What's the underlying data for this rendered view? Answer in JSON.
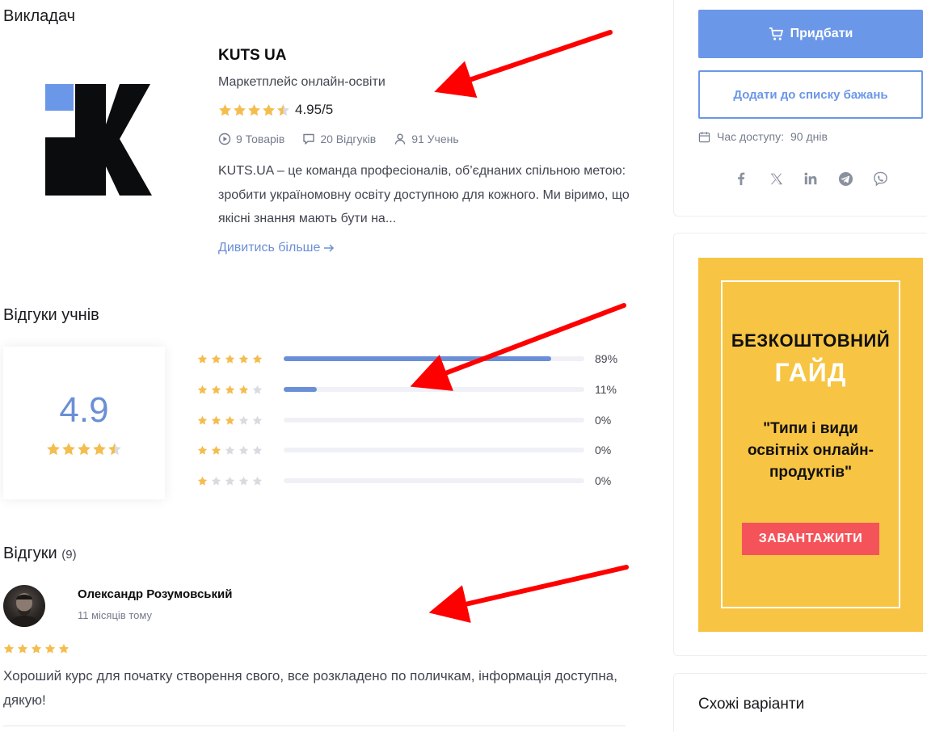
{
  "instructor": {
    "section_title": "Викладач",
    "name": "KUTS UA",
    "subtitle": "Маркетплейс онлайн-освіти",
    "rating": "4.95/5",
    "products": "9 Товарів",
    "reviews": "20 Відгуків",
    "students": "91 Учень",
    "description": "KUTS.UA – це команда професіоналів, об’єднаних спільною метою: зробити україномовну освіту доступною для кожного. Ми віримо, що якісні знання мають бути на...",
    "more_link": "Дивитись більше"
  },
  "ratings_summary": {
    "title": "Відгуки учнів",
    "average": "4.9",
    "breakdown": [
      {
        "stars": 5,
        "percent_label": "89%",
        "fraction": 0.89
      },
      {
        "stars": 4,
        "percent_label": "11%",
        "fraction": 0.11
      },
      {
        "stars": 3,
        "percent_label": "0%",
        "fraction": 0
      },
      {
        "stars": 2,
        "percent_label": "0%",
        "fraction": 0
      },
      {
        "stars": 1,
        "percent_label": "0%",
        "fraction": 0
      }
    ]
  },
  "reviews": {
    "title": "Відгуки",
    "count": "(9)",
    "items": [
      {
        "author": "Олександр Розумовський",
        "time": "11 місяців тому",
        "stars": 5,
        "text": "Хороший курс для початку створення свого, все розкладено по поличкам, інформація доступна, дякую!"
      }
    ]
  },
  "sidebar": {
    "buy_label": "Придбати",
    "wishlist_label": "Додати до списку бажань",
    "access_label": "Час доступу:",
    "access_value": "90 днів",
    "social_icons": [
      "facebook-icon",
      "x-icon",
      "linkedin-icon",
      "telegram-icon",
      "viber-icon"
    ],
    "promo": {
      "line1": "БЕЗКОШТОВНИЙ",
      "line2": "ГАЙД",
      "text": "\"Типи і види освітніх онлайн-продуктів\"",
      "button": "ЗАВАНТАЖИТИ"
    },
    "similar_title": "Схожі варіанти"
  },
  "colors": {
    "accent": "#6b97e8",
    "star": "#f4bd4f",
    "promo_bg": "#f7c443",
    "promo_btn": "#f5535a",
    "arrow": "#ff0000"
  }
}
